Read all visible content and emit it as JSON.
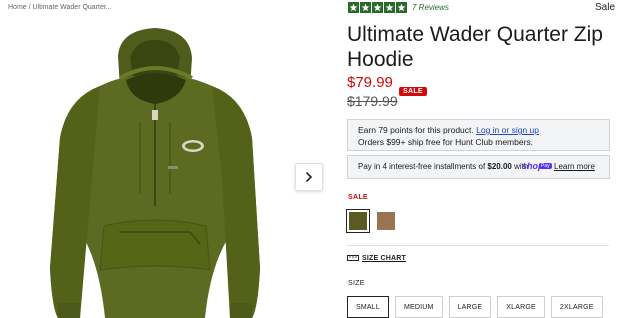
{
  "breadcrumb": {
    "home": "Home",
    "separator": "/",
    "current": "Ultimate Wader Quarter..."
  },
  "rating": {
    "stars": 5,
    "max": 5,
    "reviews_label": "7 Reviews",
    "color": "#2a6a2a"
  },
  "top_badge": "Sale",
  "product": {
    "title": "Ultimate Wader Quarter Zip Hoodie",
    "price": "$79.99",
    "original_price": "$179.99",
    "sale_badge": "SALE",
    "image_icon": "hoodie-image"
  },
  "points": {
    "line1_text": "Earn 79 points for this product. ",
    "line1_link": "Log in or sign up",
    "line2_text": "Orders $99+ ship free for Hunt Club members."
  },
  "installments": {
    "text_before": "Pay in 4 interest-free installments of ",
    "amount": "$20.00",
    "text_after": " with ",
    "logo": "shop",
    "logo_badge": "Pay",
    "learn_more": "Learn more"
  },
  "color_picker": {
    "label": "SALE",
    "swatches": [
      {
        "name": "olive",
        "hex": "#5b5a24",
        "selected": true
      },
      {
        "name": "tan",
        "hex": "#9a7353",
        "selected": false
      }
    ]
  },
  "size_chart": {
    "label": "SIZE CHART",
    "icon": "ruler-icon"
  },
  "size_picker": {
    "label": "SIZE",
    "options": [
      "SMALL",
      "MEDIUM",
      "LARGE",
      "XLARGE",
      "2XLARGE"
    ],
    "selected": "SMALL"
  },
  "carousel": {
    "next_icon": "chevron-right-icon"
  },
  "colors": {
    "accent_red": "#d10a0a",
    "link_blue": "#1f45c6",
    "shop_purple": "#5a31f4",
    "hoodie_green": "#5c6b21"
  }
}
